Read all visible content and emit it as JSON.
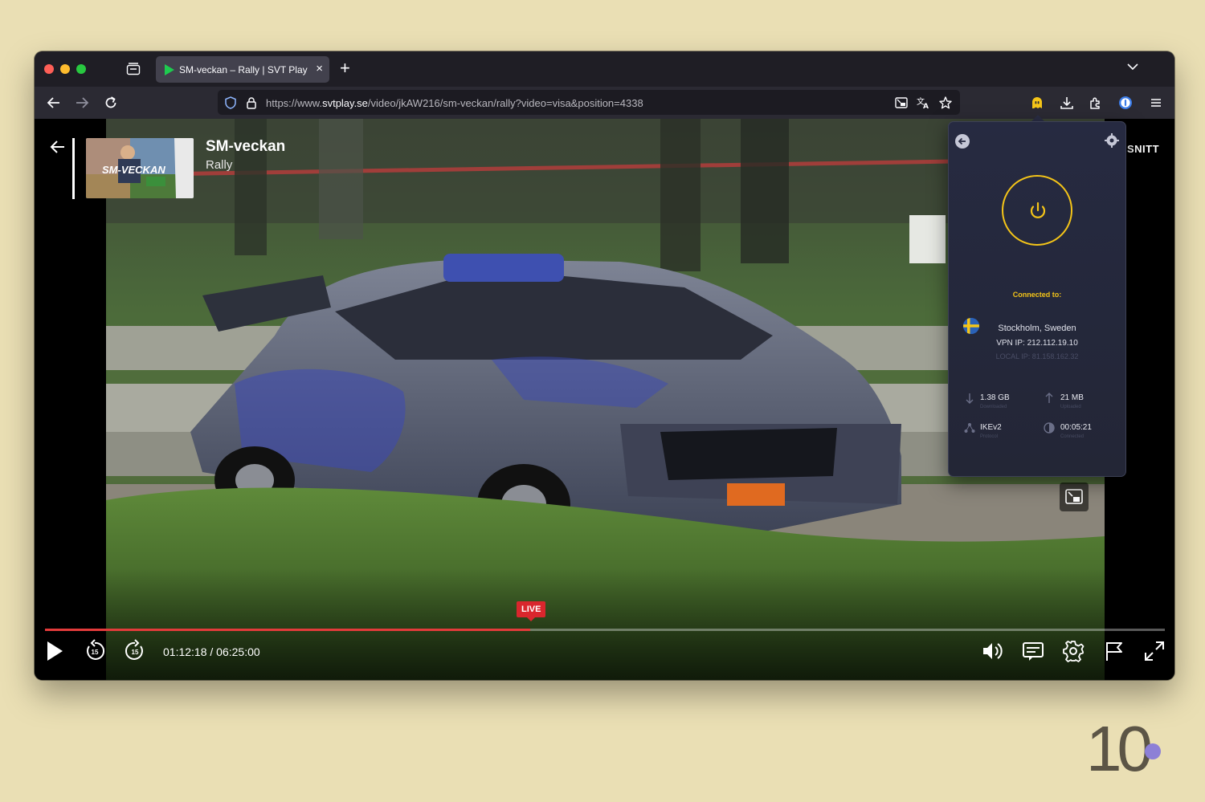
{
  "browser": {
    "tab_title": "SM-veckan – Rally | SVT Play",
    "tab_close": "×",
    "new_tab": "+",
    "url_prefix": "https://www.",
    "url_host": "svtplay.se",
    "url_path": "/video/jkAW216/sm-veckan/rally?video=visa&position=4338"
  },
  "player": {
    "title": "SM-veckan",
    "subtitle": "Rally",
    "thumbnail_text": "SM-VECKAN",
    "side_label": "SNITT",
    "live_label": "LIVE",
    "time": "01:12:18 / 06:25:00",
    "progress_fraction": 0.433,
    "buffer_fraction": 0.188,
    "accent_color": "#e33b3b"
  },
  "vpn": {
    "connected_label": "Connected to:",
    "location": "Stockholm, Sweden",
    "vpn_ip": "VPN IP: 212.112.19.10",
    "local_ip": "LOCAL IP: 81.158.162.32",
    "downloaded": "1.38 GB",
    "downloaded_label": "Downloaded",
    "uploaded": "21 MB",
    "uploaded_label": "Uploaded",
    "protocol": "IKEv2",
    "protocol_label": "Protocol",
    "duration": "00:05:21",
    "duration_label": "Connected",
    "accent_color": "#f5c518"
  },
  "watermark": {
    "logo_text": "10"
  }
}
